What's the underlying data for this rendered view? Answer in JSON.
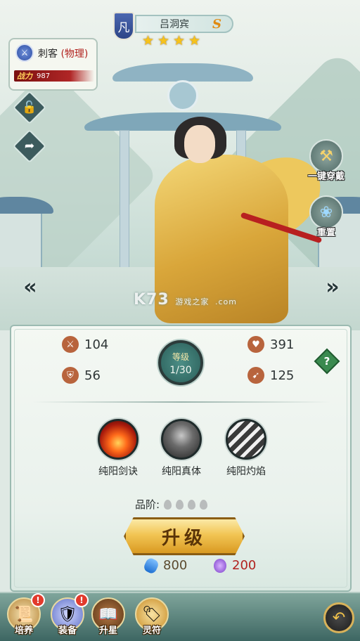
{
  "hero": {
    "rank": "凡",
    "name": "吕洞宾",
    "grade": "S",
    "stars": [
      "★",
      "★",
      "★",
      "★"
    ]
  },
  "class_card": {
    "class_name": "刺客",
    "damage_type": "(物理)",
    "power_label": "战力",
    "power_value": "987"
  },
  "side_buttons": {
    "lock_icon": "🔓",
    "share_icon": "➦"
  },
  "right_actions": {
    "one_click_equip": "一键穿戴",
    "reset": "重置"
  },
  "watermark": {
    "main": "K73",
    "sub": "游戏之家",
    "domain": ".com"
  },
  "stats": {
    "attack": "104",
    "defense": "56",
    "hp": "391",
    "speed": "125",
    "level_label": "等级",
    "level_value": "1/30",
    "help": "?"
  },
  "skills": [
    {
      "name": "纯阳剑诀"
    },
    {
      "name": "纯阳真体"
    },
    {
      "name": "纯阳灼焰"
    }
  ],
  "quality": {
    "label": "品阶:"
  },
  "upgrade": {
    "label": "升级",
    "cost_gem": "800",
    "cost_orb": "200"
  },
  "bottom_nav": [
    {
      "label": "培养",
      "alert": "!"
    },
    {
      "label": "装备",
      "alert": "!"
    },
    {
      "label": "升星"
    },
    {
      "label": "灵符"
    }
  ],
  "colors": {
    "accent_gold": "#f2c554",
    "alert_red": "#e23a2c",
    "panel_border": "#9bbab1"
  }
}
